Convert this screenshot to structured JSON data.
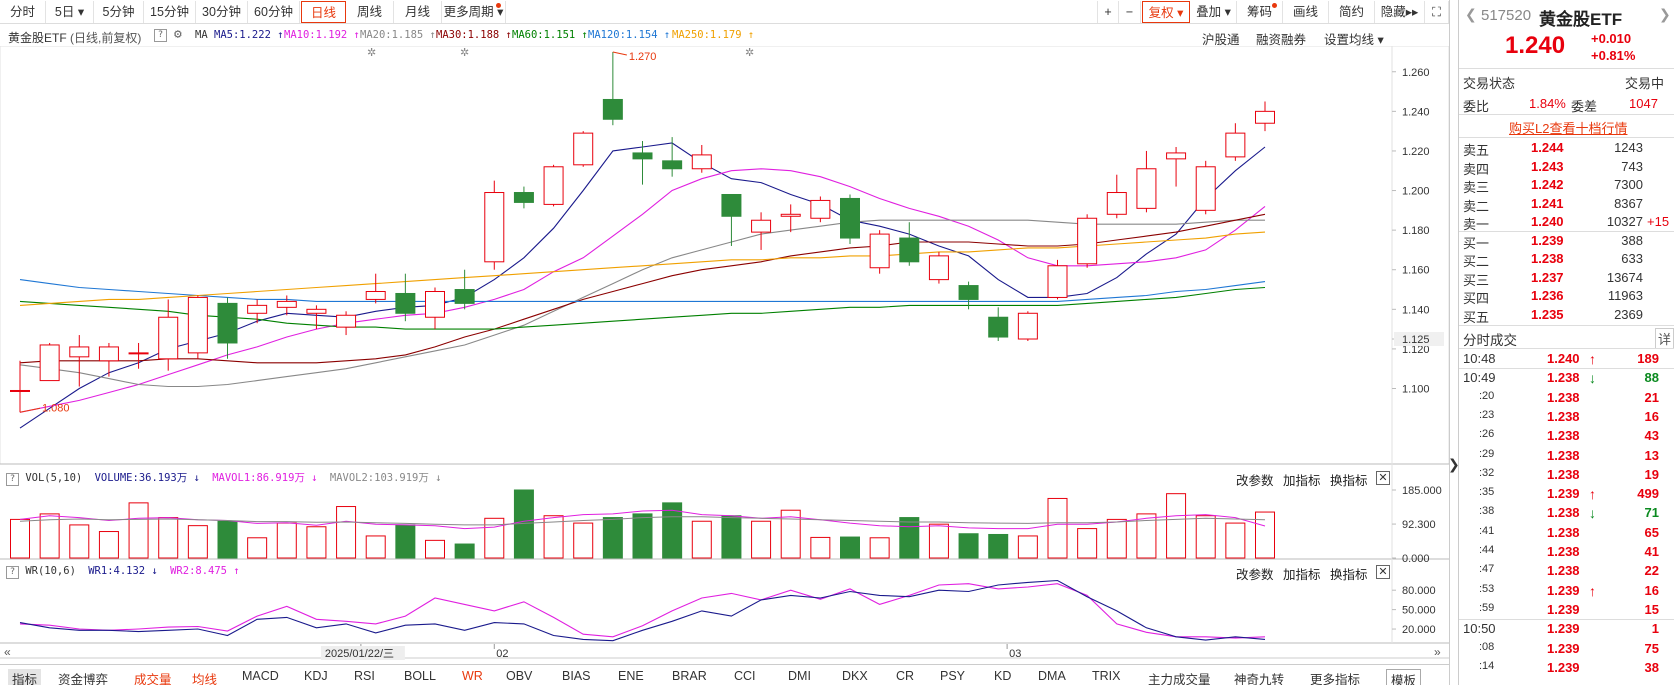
{
  "toolbar": {
    "tabs": [
      "分时",
      "5日",
      "5分钟",
      "15分钟",
      "30分钟",
      "60分钟",
      "日线",
      "周线",
      "月线",
      "更多周期"
    ],
    "active": "日线",
    "right_buttons": [
      "+",
      "−",
      "复权",
      "叠加",
      "筹码",
      "画线",
      "简约",
      "隐藏"
    ]
  },
  "legend": {
    "stock": "黄金股ETF",
    "mode": "(日线,前复权)",
    "ma_label": "MA",
    "ma": [
      {
        "name": "MA5",
        "value": "1.222",
        "arrow": "↑",
        "color": "#1a1a8c"
      },
      {
        "name": "MA10",
        "value": "1.192",
        "arrow": "↑",
        "color": "#e020e0"
      },
      {
        "name": "MA20",
        "value": "1.185",
        "arrow": "↑",
        "color": "#888888"
      },
      {
        "name": "MA30",
        "value": "1.188",
        "arrow": "↑",
        "color": "#8b0000"
      },
      {
        "name": "MA60",
        "value": "1.151",
        "arrow": "↑",
        "color": "#008000"
      },
      {
        "name": "MA120",
        "value": "1.154",
        "arrow": "↑",
        "color": "#1f77d4"
      },
      {
        "name": "MA250",
        "value": "1.179",
        "arrow": "↑",
        "color": "#f0a000"
      }
    ],
    "links": [
      "沪股通",
      "融资融券",
      "设置均线"
    ]
  },
  "vol_header": {
    "label": "VOL(5,10)",
    "items": [
      {
        "text": "VOLUME:36.193万 ↓",
        "color": "#1a1a8c"
      },
      {
        "text": "MAVOL1:86.919万 ↓",
        "color": "#e020e0"
      },
      {
        "text": "MAVOL2:103.919万 ↓",
        "color": "#888888"
      }
    ],
    "buttons": [
      "改参数",
      "加指标",
      "换指标"
    ]
  },
  "wr_header": {
    "label": "WR(10,6)",
    "items": [
      {
        "text": "WR1:4.132 ↓",
        "color": "#1a1a8c"
      },
      {
        "text": "WR2:8.475 ↑",
        "color": "#e020e0"
      }
    ],
    "buttons": [
      "改参数",
      "加指标",
      "换指标"
    ]
  },
  "bottom_tabs": [
    "指标",
    "资金博弈",
    "成交量",
    "均线",
    "MACD",
    "KDJ",
    "RSI",
    "BOLL",
    "WR",
    "OBV",
    "BIAS",
    "ENE",
    "BRAR",
    "CCI",
    "DMI",
    "DKX",
    "CR",
    "PSY",
    "KD",
    "DMA",
    "TRIX",
    "主力成交量",
    "神奇九转",
    "更多指标",
    "模板"
  ],
  "chart_data": [
    {
      "type": "candlestick",
      "title": "黄金股ETF",
      "yticks": [
        "1.260",
        "1.240",
        "1.220",
        "1.200",
        "1.180",
        "1.160",
        "1.140",
        "1.125",
        "1.120",
        "1.100"
      ],
      "ylim": [
        1.075,
        1.272
      ],
      "x_labels": [
        "2025/01/22/三",
        "02",
        "03"
      ],
      "annotations": {
        "high": "1.270",
        "low": "1.080",
        "last": "1.125"
      },
      "candles": [
        [
          1.099,
          1.099,
          1.088,
          1.114
        ],
        [
          1.104,
          1.122,
          1.104,
          1.123
        ],
        [
          1.116,
          1.121,
          1.101,
          1.127
        ],
        [
          1.114,
          1.121,
          1.106,
          1.123
        ],
        [
          1.118,
          1.118,
          1.11,
          1.123
        ],
        [
          1.115,
          1.136,
          1.109,
          1.145
        ],
        [
          1.118,
          1.146,
          1.115,
          1.147
        ],
        [
          1.143,
          1.123,
          1.115,
          1.146
        ],
        [
          1.138,
          1.142,
          1.133,
          1.145
        ],
        [
          1.141,
          1.144,
          1.137,
          1.147
        ],
        [
          1.138,
          1.14,
          1.13,
          1.142
        ],
        [
          1.131,
          1.137,
          1.127,
          1.139
        ],
        [
          1.145,
          1.149,
          1.143,
          1.158
        ],
        [
          1.148,
          1.138,
          1.134,
          1.158
        ],
        [
          1.136,
          1.149,
          1.13,
          1.151
        ],
        [
          1.15,
          1.143,
          1.14,
          1.16
        ],
        [
          1.164,
          1.199,
          1.16,
          1.205
        ],
        [
          1.199,
          1.194,
          1.191,
          1.202
        ],
        [
          1.193,
          1.212,
          1.192,
          1.213
        ],
        [
          1.213,
          1.229,
          1.212,
          1.23
        ],
        [
          1.246,
          1.236,
          1.233,
          1.27
        ],
        [
          1.219,
          1.216,
          1.203,
          1.225
        ],
        [
          1.215,
          1.211,
          1.207,
          1.227
        ],
        [
          1.211,
          1.218,
          1.209,
          1.223
        ],
        [
          1.198,
          1.187,
          1.172,
          1.198
        ],
        [
          1.179,
          1.185,
          1.17,
          1.189
        ],
        [
          1.187,
          1.188,
          1.179,
          1.193
        ],
        [
          1.186,
          1.195,
          1.184,
          1.197
        ],
        [
          1.196,
          1.176,
          1.173,
          1.198
        ],
        [
          1.161,
          1.178,
          1.158,
          1.18
        ],
        [
          1.176,
          1.164,
          1.162,
          1.184
        ],
        [
          1.155,
          1.167,
          1.153,
          1.169
        ],
        [
          1.152,
          1.145,
          1.14,
          1.154
        ],
        [
          1.136,
          1.126,
          1.124,
          1.141
        ],
        [
          1.125,
          1.138,
          1.124,
          1.139
        ],
        [
          1.146,
          1.162,
          1.145,
          1.165
        ],
        [
          1.163,
          1.186,
          1.161,
          1.188
        ],
        [
          1.188,
          1.199,
          1.186,
          1.208
        ],
        [
          1.191,
          1.211,
          1.189,
          1.22
        ],
        [
          1.216,
          1.219,
          1.202,
          1.222
        ],
        [
          1.19,
          1.212,
          1.188,
          1.215
        ],
        [
          1.217,
          1.229,
          1.215,
          1.234
        ],
        [
          1.234,
          1.24,
          1.23,
          1.245
        ]
      ],
      "ma": {
        "MA5": [
          1.08,
          1.09,
          1.1,
          1.108,
          1.113,
          1.12,
          1.124,
          1.128,
          1.134,
          1.138,
          1.137,
          1.136,
          1.139,
          1.141,
          1.142,
          1.146,
          1.155,
          1.166,
          1.181,
          1.2,
          1.22,
          1.222,
          1.224,
          1.214,
          1.206,
          1.204,
          1.198,
          1.193,
          1.185,
          1.182,
          1.178,
          1.172,
          1.167,
          1.155,
          1.146,
          1.146,
          1.148,
          1.156,
          1.168,
          1.178,
          1.196,
          1.21,
          1.222
        ],
        "MA10": [
          1.088,
          1.091,
          1.094,
          1.098,
          1.102,
          1.107,
          1.112,
          1.117,
          1.121,
          1.126,
          1.13,
          1.133,
          1.135,
          1.137,
          1.138,
          1.141,
          1.145,
          1.15,
          1.159,
          1.166,
          1.177,
          1.188,
          1.2,
          1.206,
          1.21,
          1.211,
          1.21,
          1.207,
          1.202,
          1.196,
          1.191,
          1.187,
          1.182,
          1.175,
          1.166,
          1.162,
          1.162,
          1.163,
          1.164,
          1.166,
          1.17,
          1.18,
          1.192
        ],
        "MA20": [
          1.112,
          1.11,
          1.108,
          1.105,
          1.102,
          1.101,
          1.101,
          1.102,
          1.104,
          1.106,
          1.108,
          1.11,
          1.113,
          1.116,
          1.119,
          1.122,
          1.127,
          1.132,
          1.139,
          1.146,
          1.153,
          1.16,
          1.166,
          1.17,
          1.174,
          1.178,
          1.18,
          1.182,
          1.184,
          1.185,
          1.185,
          1.185,
          1.185,
          1.185,
          1.185,
          1.184,
          1.183,
          1.183,
          1.183,
          1.183,
          1.184,
          1.185,
          1.185
        ],
        "MA30": [
          1.113,
          1.114,
          1.114,
          1.114,
          1.114,
          1.115,
          1.115,
          1.114,
          1.113,
          1.113,
          1.113,
          1.114,
          1.115,
          1.117,
          1.121,
          1.126,
          1.13,
          1.135,
          1.14,
          1.145,
          1.149,
          1.153,
          1.157,
          1.16,
          1.162,
          1.164,
          1.167,
          1.169,
          1.171,
          1.172,
          1.174,
          1.174,
          1.174,
          1.173,
          1.172,
          1.172,
          1.173,
          1.175,
          1.177,
          1.179,
          1.182,
          1.185,
          1.188
        ],
        "MA60": [
          1.144,
          1.143,
          1.142,
          1.141,
          1.14,
          1.139,
          1.137,
          1.136,
          1.135,
          1.133,
          1.132,
          1.131,
          1.131,
          1.13,
          1.13,
          1.13,
          1.13,
          1.131,
          1.132,
          1.133,
          1.134,
          1.135,
          1.136,
          1.137,
          1.138,
          1.138,
          1.139,
          1.14,
          1.141,
          1.141,
          1.142,
          1.142,
          1.142,
          1.142,
          1.142,
          1.142,
          1.143,
          1.144,
          1.145,
          1.146,
          1.148,
          1.15,
          1.151
        ],
        "MA120": [
          1.155,
          1.153,
          1.151,
          1.15,
          1.149,
          1.148,
          1.147,
          1.146,
          1.145,
          1.145,
          1.144,
          1.144,
          1.144,
          1.144,
          1.144,
          1.144,
          1.144,
          1.144,
          1.144,
          1.144,
          1.144,
          1.144,
          1.144,
          1.144,
          1.144,
          1.144,
          1.144,
          1.144,
          1.144,
          1.144,
          1.144,
          1.144,
          1.144,
          1.144,
          1.144,
          1.144,
          1.145,
          1.146,
          1.147,
          1.149,
          1.15,
          1.152,
          1.154
        ],
        "MA250": [
          1.142,
          1.143,
          1.144,
          1.145,
          1.145,
          1.146,
          1.147,
          1.148,
          1.149,
          1.15,
          1.151,
          1.152,
          1.153,
          1.154,
          1.155,
          1.156,
          1.157,
          1.158,
          1.159,
          1.16,
          1.161,
          1.162,
          1.163,
          1.164,
          1.165,
          1.165,
          1.166,
          1.166,
          1.167,
          1.167,
          1.168,
          1.169,
          1.169,
          1.17,
          1.171,
          1.171,
          1.172,
          1.173,
          1.174,
          1.175,
          1.176,
          1.178,
          1.179
        ]
      },
      "ma_colors": {
        "MA5": "#1a1a8c",
        "MA10": "#e020e0",
        "MA20": "#888888",
        "MA30": "#8b0000",
        "MA60": "#008000",
        "MA120": "#1f77d4",
        "MA250": "#f0a000"
      }
    },
    {
      "type": "bar",
      "title": "VOL(5,10)",
      "yticks": [
        "185.000",
        "92.300",
        "0.000"
      ],
      "ylim": [
        0,
        185
      ],
      "values": [
        105,
        120,
        90,
        72,
        150,
        110,
        88,
        100,
        55,
        95,
        85,
        140,
        60,
        90,
        48,
        38,
        108,
        185,
        115,
        95,
        110,
        120,
        150,
        100,
        115,
        100,
        130,
        56,
        57,
        55,
        110,
        92,
        66,
        64,
        60,
        162,
        80,
        105,
        120,
        175,
        115,
        95,
        125
      ],
      "mavol1": [
        105,
        115,
        110,
        102,
        108,
        110,
        104,
        102,
        94,
        96,
        89,
        100,
        92,
        90,
        88,
        80,
        84,
        100,
        110,
        118,
        120,
        128,
        130,
        118,
        115,
        108,
        112,
        104,
        95,
        88,
        85,
        88,
        82,
        80,
        80,
        92,
        92,
        98,
        108,
        115,
        118,
        110,
        87
      ],
      "mavol2": [
        100,
        104,
        106,
        104,
        105,
        106,
        104,
        102,
        99,
        99,
        97,
        98,
        96,
        94,
        92,
        90,
        90,
        94,
        98,
        102,
        105,
        110,
        112,
        112,
        110,
        108,
        106,
        104,
        102,
        100,
        98,
        98,
        96,
        95,
        94,
        96,
        96,
        98,
        102,
        105,
        108,
        106,
        104
      ]
    },
    {
      "type": "line",
      "title": "WR(10,6)",
      "yticks": [
        "80.000",
        "50.000",
        "20.000"
      ],
      "ylim": [
        0,
        105
      ],
      "wr1": [
        30,
        22,
        18,
        18,
        16,
        18,
        20,
        10,
        35,
        38,
        22,
        28,
        14,
        26,
        28,
        18,
        30,
        28,
        10,
        4,
        2,
        18,
        32,
        48,
        40,
        65,
        72,
        68,
        78,
        72,
        70,
        80,
        78,
        88,
        92,
        95,
        70,
        48,
        22,
        8,
        3,
        8,
        4
      ],
      "wr2": [
        28,
        26,
        20,
        18,
        20,
        23,
        24,
        17,
        40,
        55,
        35,
        32,
        28,
        40,
        68,
        58,
        48,
        62,
        38,
        12,
        8,
        25,
        48,
        68,
        75,
        65,
        80,
        66,
        82,
        58,
        72,
        88,
        90,
        82,
        85,
        90,
        72,
        28,
        15,
        8,
        8,
        6,
        8
      ]
    }
  ],
  "quote": {
    "code": "517520",
    "name": "黄金股ETF",
    "price": "1.240",
    "change": "+0.010",
    "change_pct": "+0.81%",
    "status_label": "交易状态",
    "status_value": "交易中",
    "weibi_label": "委比",
    "weibi_value": "1.84%",
    "weicha_label": "委差",
    "weicha_value": "1047",
    "l2_link": "购买L2查看十档行情",
    "sells": [
      {
        "label": "卖五",
        "price": "1.244",
        "vol": "1243",
        "chg": ""
      },
      {
        "label": "卖四",
        "price": "1.243",
        "vol": "743",
        "chg": ""
      },
      {
        "label": "卖三",
        "price": "1.242",
        "vol": "7300",
        "chg": ""
      },
      {
        "label": "卖二",
        "price": "1.241",
        "vol": "8367",
        "chg": ""
      },
      {
        "label": "卖一",
        "price": "1.240",
        "vol": "10327",
        "chg": "+15"
      }
    ],
    "buys": [
      {
        "label": "买一",
        "price": "1.239",
        "vol": "388"
      },
      {
        "label": "买二",
        "price": "1.238",
        "vol": "633"
      },
      {
        "label": "买三",
        "price": "1.237",
        "vol": "13674"
      },
      {
        "label": "买四",
        "price": "1.236",
        "vol": "11963"
      },
      {
        "label": "买五",
        "price": "1.235",
        "vol": "2369"
      }
    ],
    "ticks_title": "分时成交",
    "ticks_detail": "详",
    "ticks": [
      {
        "time": "10:48",
        "price": "1.240",
        "dir": "↑",
        "vol": "189",
        "bold": true
      },
      {
        "time": "10:49",
        "price": "1.238",
        "dir": "↓",
        "vol": "88",
        "bold": true
      },
      {
        "time": ":20",
        "price": "1.238",
        "dir": "",
        "vol": "21",
        "bold": false
      },
      {
        "time": ":23",
        "price": "1.238",
        "dir": "",
        "vol": "16",
        "bold": false
      },
      {
        "time": ":26",
        "price": "1.238",
        "dir": "",
        "vol": "43",
        "bold": false
      },
      {
        "time": ":29",
        "price": "1.238",
        "dir": "",
        "vol": "13",
        "bold": false
      },
      {
        "time": ":32",
        "price": "1.238",
        "dir": "",
        "vol": "19",
        "bold": false
      },
      {
        "time": ":35",
        "price": "1.239",
        "dir": "↑",
        "vol": "499",
        "bold": false
      },
      {
        "time": ":38",
        "price": "1.238",
        "dir": "↓",
        "vol": "71",
        "bold": false
      },
      {
        "time": ":41",
        "price": "1.238",
        "dir": "",
        "vol": "65",
        "bold": false
      },
      {
        "time": ":44",
        "price": "1.238",
        "dir": "",
        "vol": "41",
        "bold": false
      },
      {
        "time": ":47",
        "price": "1.238",
        "dir": "",
        "vol": "22",
        "bold": false
      },
      {
        "time": ":53",
        "price": "1.239",
        "dir": "↑",
        "vol": "16",
        "bold": false
      },
      {
        "time": ":59",
        "price": "1.239",
        "dir": "",
        "vol": "15",
        "bold": false
      },
      {
        "time": "10:50",
        "price": "1.239",
        "dir": "",
        "vol": "1",
        "bold": true
      },
      {
        "time": ":08",
        "price": "1.239",
        "dir": "",
        "vol": "75",
        "bold": false
      },
      {
        "time": ":14",
        "price": "1.239",
        "dir": "",
        "vol": "38",
        "bold": false
      }
    ]
  },
  "colors": {
    "up": "#e8000d",
    "down": "#2e8b3a",
    "accent": "#e8380d",
    "wr1": "#1a1a8c",
    "wr2": "#e020e0"
  }
}
